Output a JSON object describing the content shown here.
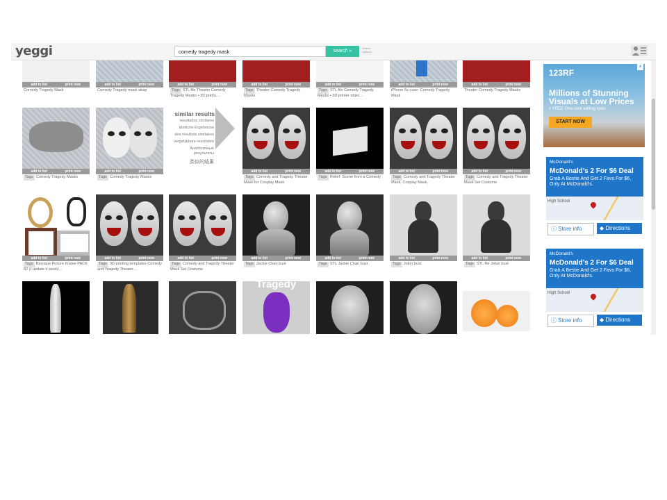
{
  "header": {
    "logo": "yeggi",
    "search_value": "comedy tragedy mask",
    "search_button": "search »",
    "search_options": [
      "Search",
      "Options"
    ]
  },
  "actions": {
    "add": "add to list",
    "print": "print now"
  },
  "tag_label": "Tags",
  "row1": [
    {
      "caption": "Comedy Tragedy Mask"
    },
    {
      "caption": "Comedy Tragedy mask strap"
    },
    {
      "caption": "STL file Theater Comedy Tragedy Masks • 3D printa…"
    },
    {
      "caption": "Theater Comedy Tragedy Masks"
    },
    {
      "caption": "STL file Comedy Tragedy Masks • 3D printer objec…"
    },
    {
      "caption": "iPhone 6s case- Comedy Tragedy Mask"
    },
    {
      "caption": "Theater Comedy Tragedy Masks"
    }
  ],
  "row2": [
    {
      "caption": "Comedy Tragedy Masks"
    },
    {
      "caption": "Comedy Tragedy Masks"
    },
    {
      "caption": "Comedy and Tragedy Theater Mask for Cosplay Mask"
    },
    {
      "caption": "Relief: Scene from a Comedy"
    },
    {
      "caption": "Comedy and Tragedy Theater Mask, Cosplay Mask,"
    },
    {
      "caption": "Comedy and Tragedy Theater Mask Set Costume"
    }
  ],
  "similar": {
    "title": "similar results",
    "lines": [
      "resultados similares",
      "ähnliche Ergebnisse",
      "des résultats similaires",
      "vergelijkbare resultaten",
      "Аналогичные",
      "результаты",
      "类似的结果"
    ]
  },
  "row3": [
    {
      "caption": "Baroque Picture Frame PACK 82 (I update it weekl…"
    },
    {
      "caption": "3D printing templates Comedy and Tragedy Theater…"
    },
    {
      "caption": "Comedy and Tragedy Theater Mask Set Costume"
    },
    {
      "caption": "Jackie Chan bust"
    },
    {
      "caption": "STL Jackie Chan bust"
    },
    {
      "caption": "Joker bust"
    },
    {
      "caption": "STL file Joker bust"
    }
  ],
  "row4_label": "Tragedy",
  "ads": {
    "rf": {
      "brand": "123RF",
      "headline": "Millions of Stunning Visuals at Low Prices",
      "sub": "+ FREE One-click editing tools",
      "button": "START NOW"
    },
    "mcd": {
      "brand": "McDonald's",
      "title": "McDonald's 2 For $6 Deal",
      "text": "Grab A Bestie And Get 2 Favs For $6, Only At McDonald's.",
      "map_label": "High School",
      "store": "Store info",
      "directions": "Directions"
    }
  }
}
